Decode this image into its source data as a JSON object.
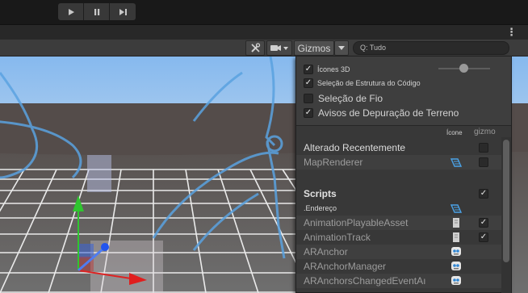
{
  "playback": {
    "play_icon": "play-icon",
    "pause_icon": "pause-icon",
    "step_icon": "step-icon"
  },
  "tabbar": {
    "more_menu": "⋮"
  },
  "scene_toolbar": {
    "tools_icon": "tools-icon",
    "camera_icon": "camera-icon",
    "gizmos_label": "Gizmos",
    "search_value": "Q: Tudo"
  },
  "gizmos_panel": {
    "options": [
      {
        "label": "Ícones 3D",
        "checked": true
      },
      {
        "label": "Seleção de Estrutura do Código",
        "checked": true
      },
      {
        "label": "Seleção de Fio",
        "checked": false
      },
      {
        "label": "Avisos de Depuração de Terreno",
        "checked": true
      }
    ],
    "icon_size_level": 0.49,
    "column_headers": {
      "icon": "Ícone",
      "gizmo": "gizmo"
    },
    "recent_section": {
      "title": "Alterado Recentemente",
      "items": [
        {
          "label": "MapRenderer",
          "icon": "script-icon",
          "gizmo_checked": false
        }
      ]
    },
    "scripts_section": {
      "title": "Scripts",
      "checked": true,
      "items": [
        {
          "label": ".Endereço",
          "icon": "script-icon",
          "gizmo_checked": null
        },
        {
          "label": "AnimationPlayableAsset",
          "icon": "asset-icon",
          "gizmo_checked": true
        },
        {
          "label": "AnimationTrack",
          "icon": "asset-icon",
          "gizmo_checked": true
        },
        {
          "label": "ARAnchor",
          "icon": "robot-icon",
          "gizmo_checked": null
        },
        {
          "label": "ARAnchorManager",
          "icon": "robot-icon",
          "gizmo_checked": null
        },
        {
          "label": "ARAnchorsChangedEventAı",
          "icon": "robot-icon",
          "gizmo_checked": null
        }
      ]
    }
  },
  "colors": {
    "background": "#191919",
    "panel": "#383838",
    "sky_top": "#7fb2e8",
    "ground": "#6e6e6e",
    "axis_y": "#33cc33",
    "axis_x": "#dd2222",
    "axis_z": "#2255ee"
  }
}
